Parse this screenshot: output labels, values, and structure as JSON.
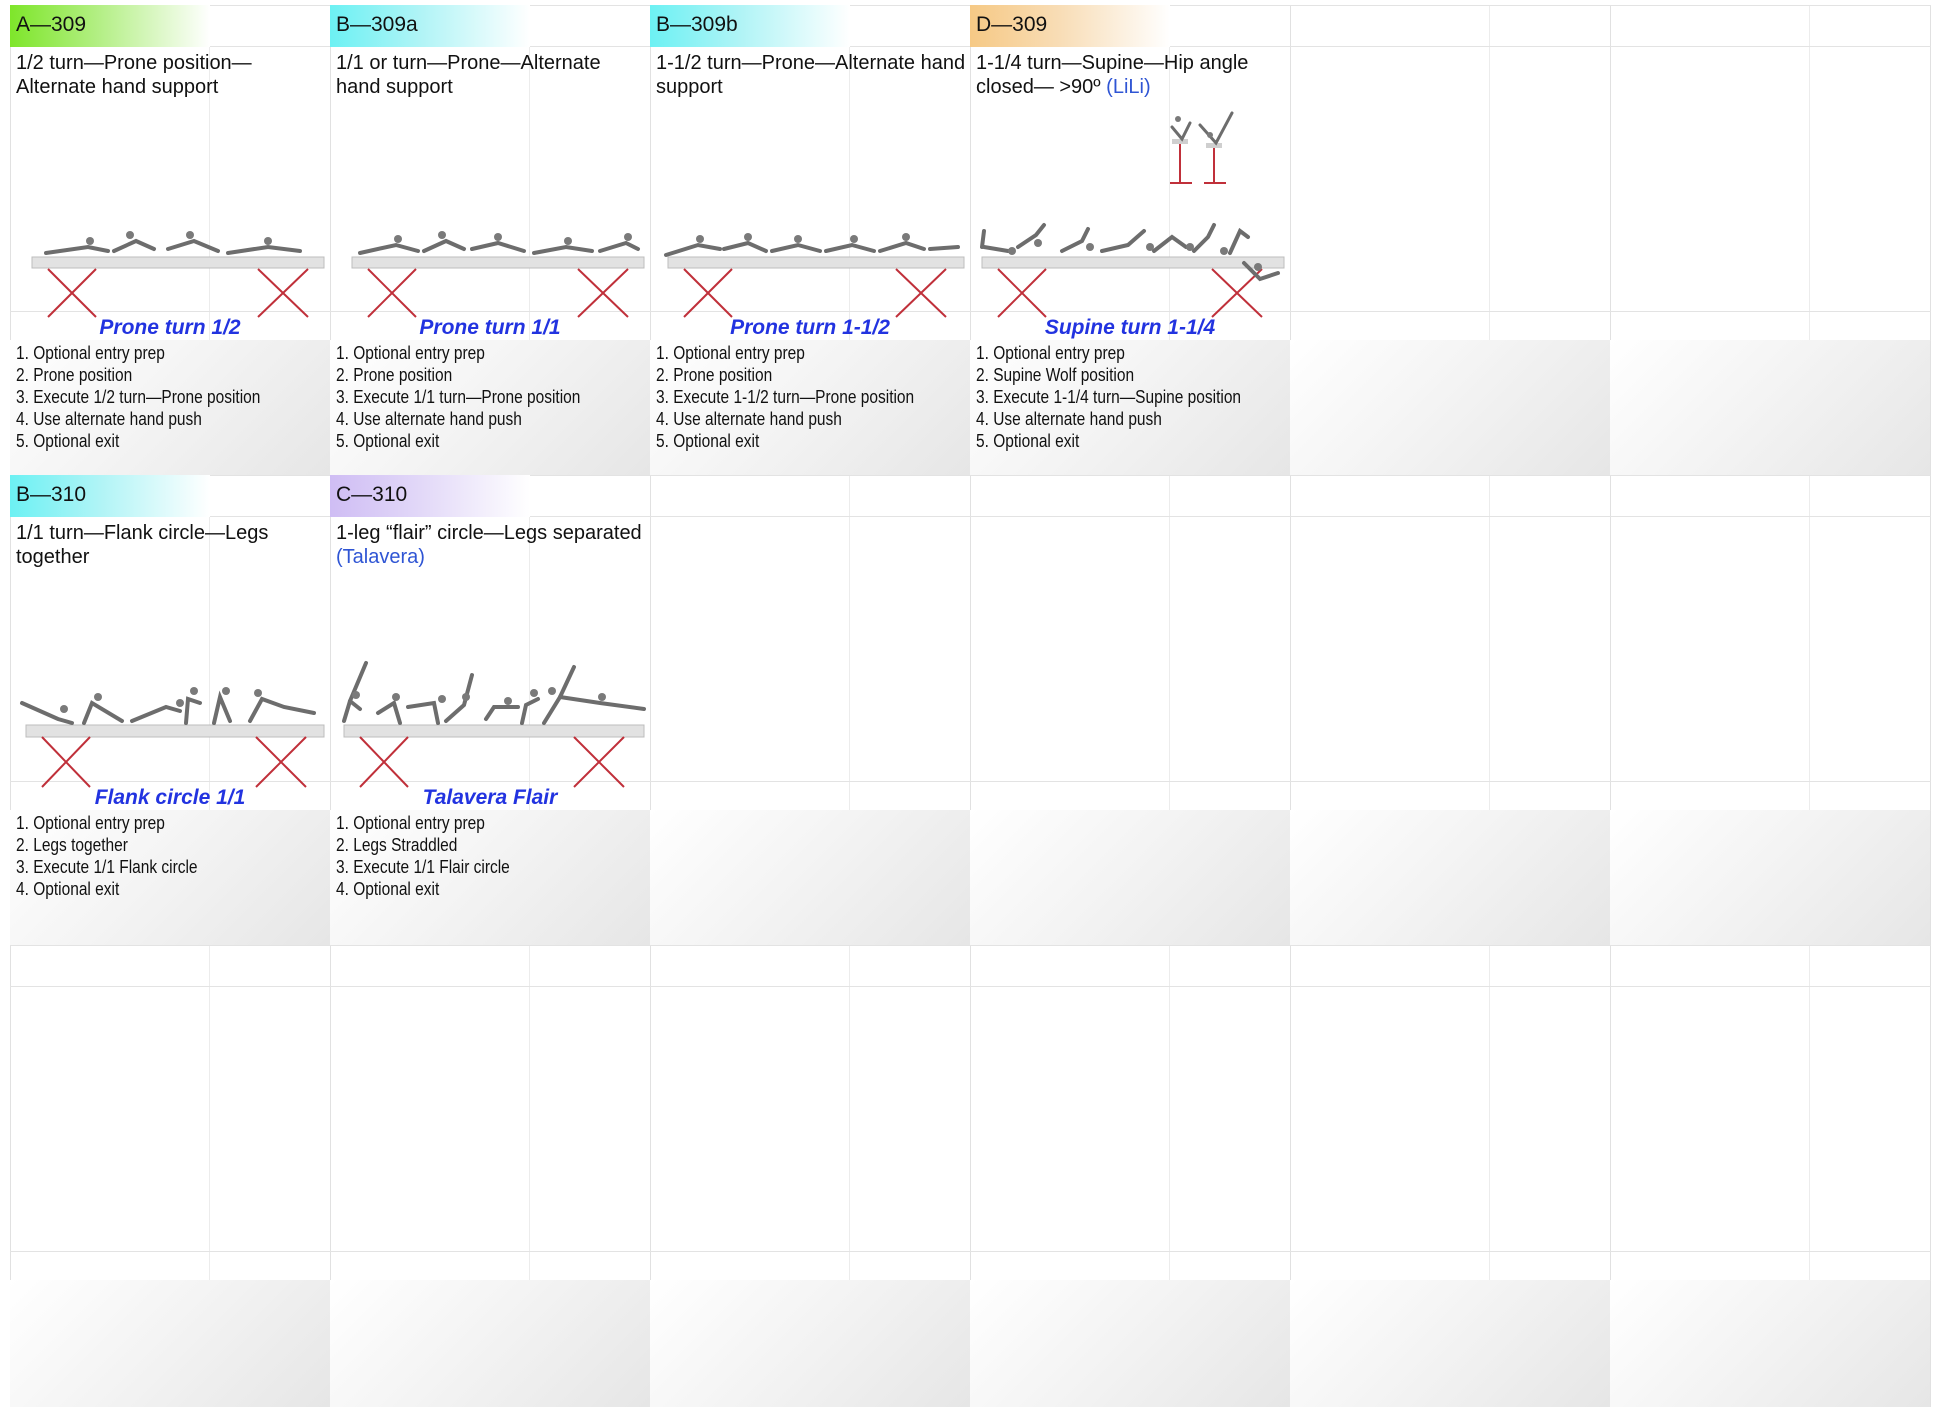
{
  "elements": [
    {
      "code": "A—309",
      "level": "a",
      "description": "1/2 turn—Prone position—Alternate hand support",
      "description_link": "",
      "name": "Prone turn 1/2",
      "steps": [
        "1. Optional entry prep",
        "2. Prone position",
        "3. Execute 1/2 turn—Prone position",
        "4. Use alternate hand push",
        "5. Optional exit"
      ],
      "figure_icon": "prone-turn-figure-icon"
    },
    {
      "code": "B—309a",
      "level": "b",
      "description": "1/1 or turn—Prone—Alternate hand support",
      "description_link": "",
      "name": "Prone turn 1/1",
      "steps": [
        "1. Optional entry prep",
        "2. Prone position",
        "3. Execute 1/1 turn—Prone position",
        "4. Use alternate hand push",
        "5. Optional exit"
      ],
      "figure_icon": "prone-turn-figure-icon"
    },
    {
      "code": "B—309b",
      "level": "b",
      "description": "1-1/2 turn—Prone—Alternate hand support",
      "description_link": "",
      "name": "Prone turn 1-1/2",
      "steps": [
        "1. Optional entry prep",
        "2. Prone position",
        "3. Execute 1-1/2 turn—Prone position",
        "4. Use alternate hand push",
        "5. Optional exit"
      ],
      "figure_icon": "prone-turn-figure-icon"
    },
    {
      "code": "D—309",
      "level": "d",
      "description": "1-1/4 turn—Supine—Hip angle closed— >90º",
      "description_link": "(LiLi)",
      "name": "Supine turn 1-1/4",
      "steps": [
        "1. Optional entry prep",
        "2. Supine Wolf position",
        "3. Execute 1-1/4 turn—Supine position",
        "4. Use alternate hand push",
        "5. Optional exit"
      ],
      "figure_icon": "supine-turn-figure-icon"
    },
    {
      "code": "B—310",
      "level": "b",
      "description": "1/1 turn—Flank circle—Legs together",
      "description_link": "",
      "name": "Flank circle 1/1",
      "steps": [
        "1. Optional entry prep",
        "2. Legs together",
        "3. Execute 1/1 Flank circle",
        "4. Optional exit"
      ],
      "figure_icon": "flank-circle-figure-icon"
    },
    {
      "code": "C—310",
      "level": "c",
      "description": "1-leg “flair” circle—Legs separated",
      "description_link": "(Talavera)",
      "name": "Talavera Flair",
      "steps": [
        "1. Optional entry prep",
        "2. Legs Straddled",
        "3. Execute 1/1 Flair circle",
        "4. Optional exit"
      ],
      "figure_icon": "flair-circle-figure-icon"
    }
  ],
  "colors": {
    "level_a": "#7ee62a",
    "level_b": "#6cf1f3",
    "level_c": "#cfbdf4",
    "level_d": "#f6c985",
    "element_name": "#2233e0",
    "author_link": "#2f55d4",
    "beam_legs": "#c0303a"
  }
}
